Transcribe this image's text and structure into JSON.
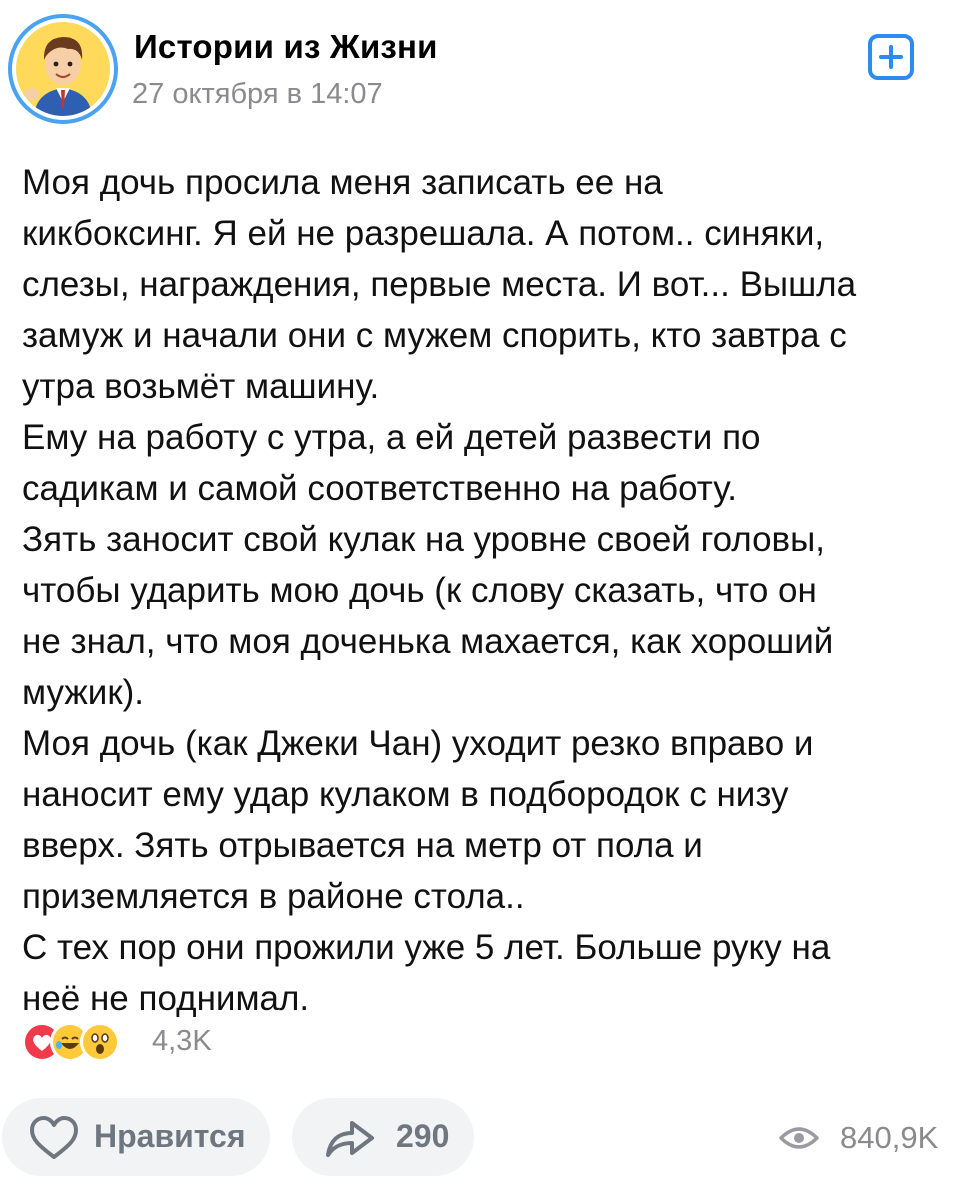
{
  "header": {
    "author": "Истории из Жизни",
    "timestamp": "27 октября в 14:07"
  },
  "post": {
    "text": "Моя дочь просила меня записать ее на\nкикбоксинг. Я ей не разрешала. А потом.. синяки,\nслезы, награждения, первые места. И вот... Вышла\nзамуж и начали они с мужем спорить, кто завтра с\nутра возьмёт машину.\nЕму на работу с утра, а ей детей развести по\nсадикам и самой соответственно на работу.\nЗять заносит свой кулак на уровне своей головы,\nчтобы ударить мою дочь (к слову сказать, что он\nне знал, что моя доченька махается, как хороший\nмужик).\nМоя дочь (как Джеки Чан) уходит резко вправо и\nнаносит ему удар кулаком в подбородок с низу\nвверх. Зять отрывается на метр от пола и\nприземляется в районе стола..\nС тех пор они прожили уже 5 лет. Больше руку на\nнеё не поднимал."
  },
  "reactions": {
    "icons": [
      "heart-icon",
      "laughing-tears-icon",
      "surprised-face-icon"
    ],
    "count": "4,3K"
  },
  "actions": {
    "like_label": "Нравится",
    "share_count": "290",
    "views_count": "840,9K"
  },
  "colors": {
    "accent": "#2a8cf0",
    "avatar_ring": "#4aa3f0",
    "muted_text": "#8a8a8f",
    "button_bg": "#f2f3f5",
    "heart": "#f03a4b",
    "emoji_yellow": "#ffc93a"
  }
}
